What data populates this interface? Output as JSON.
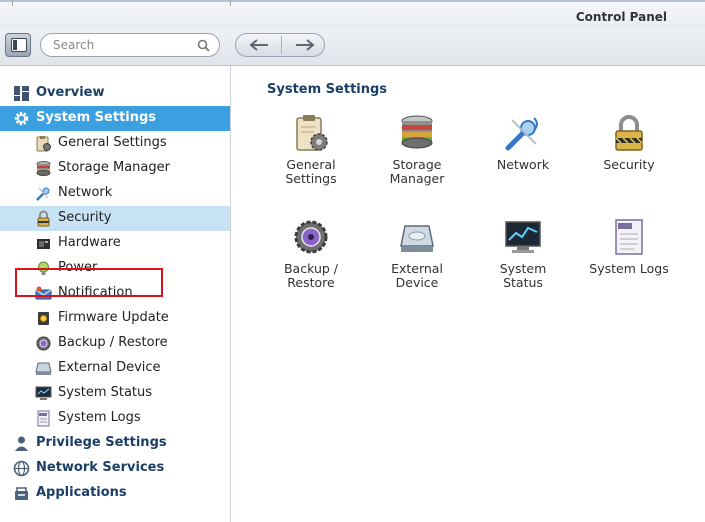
{
  "window": {
    "title": "Control Panel"
  },
  "toolbar": {
    "search_placeholder": "Search"
  },
  "sidebar": {
    "items": [
      {
        "label": "Overview",
        "icon": "grid-icon",
        "level": "top"
      },
      {
        "label": "System Settings",
        "icon": "gear-icon",
        "level": "top",
        "state": "active"
      },
      {
        "label": "General Settings",
        "icon": "clipboard-gear-icon",
        "level": "sub"
      },
      {
        "label": "Storage Manager",
        "icon": "disk-stack-icon",
        "level": "sub"
      },
      {
        "label": "Network",
        "icon": "network-plug-icon",
        "level": "sub"
      },
      {
        "label": "Security",
        "icon": "lock-icon",
        "level": "sub",
        "state": "selected"
      },
      {
        "label": "Hardware",
        "icon": "hardware-chip-icon",
        "level": "sub"
      },
      {
        "label": "Power",
        "icon": "bulb-icon",
        "level": "sub"
      },
      {
        "label": "Notification",
        "icon": "notification-icon",
        "level": "sub"
      },
      {
        "label": "Firmware Update",
        "icon": "firmware-icon",
        "level": "sub"
      },
      {
        "label": "Backup / Restore",
        "icon": "backup-icon",
        "level": "sub"
      },
      {
        "label": "External Device",
        "icon": "external-drive-icon",
        "level": "sub"
      },
      {
        "label": "System Status",
        "icon": "monitor-icon",
        "level": "sub"
      },
      {
        "label": "System Logs",
        "icon": "log-document-icon",
        "level": "sub"
      },
      {
        "label": "Privilege Settings",
        "icon": "user-icon",
        "level": "top"
      },
      {
        "label": "Network Services",
        "icon": "globe-icon",
        "level": "top"
      },
      {
        "label": "Applications",
        "icon": "applications-icon",
        "level": "top"
      }
    ]
  },
  "main": {
    "section_title": "System Settings",
    "tiles": [
      {
        "line1": "General",
        "line2": "Settings",
        "icon": "clipboard-gear-icon"
      },
      {
        "line1": "Storage",
        "line2": "Manager",
        "icon": "disk-stack-icon"
      },
      {
        "line1": "Network",
        "line2": "",
        "icon": "network-plug-icon"
      },
      {
        "line1": "Security",
        "line2": "",
        "icon": "lock-icon"
      },
      {
        "line1": "Backup /",
        "line2": "Restore",
        "icon": "backup-icon"
      },
      {
        "line1": "External",
        "line2": "Device",
        "icon": "external-drive-icon"
      },
      {
        "line1": "System",
        "line2": "Status",
        "icon": "monitor-icon"
      },
      {
        "line1": "System Logs",
        "line2": "",
        "icon": "log-document-icon"
      }
    ]
  },
  "colors": {
    "accent": "#3c9fe0",
    "selected_row": "#c7e2f5",
    "heading": "#1b3f66",
    "highlight_box": "#d7141d"
  }
}
